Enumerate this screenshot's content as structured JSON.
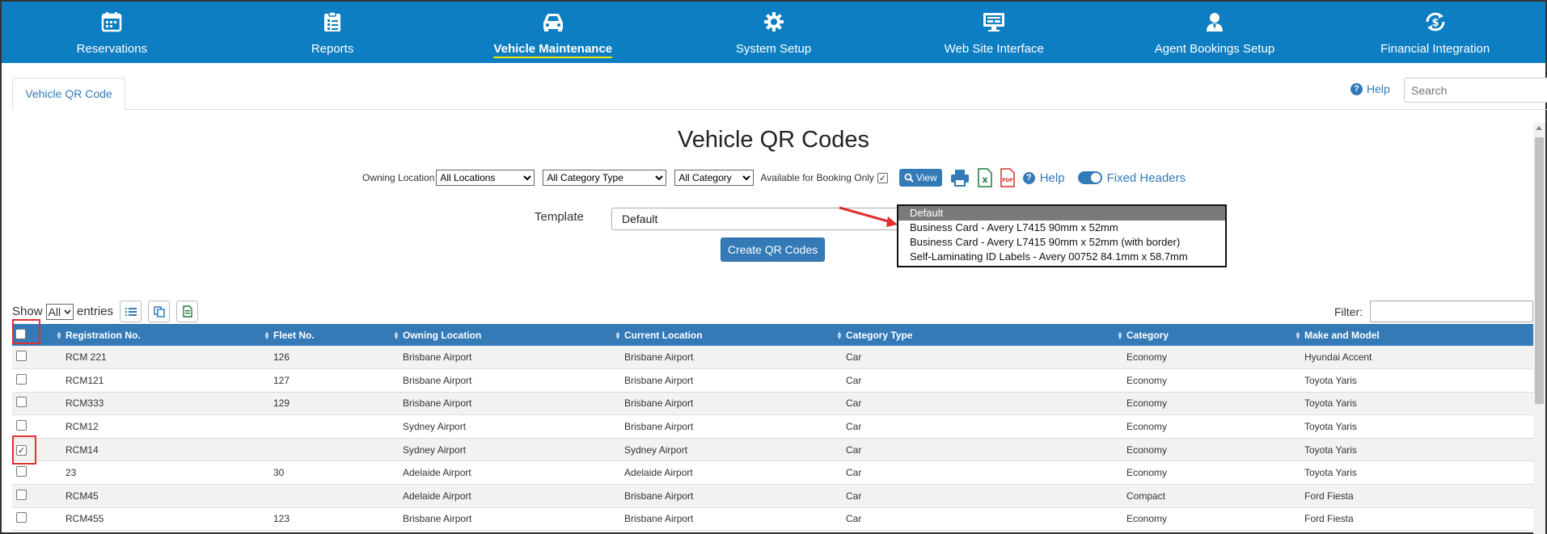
{
  "nav": {
    "items": [
      {
        "label": "Reservations",
        "icon": "calendar-icon"
      },
      {
        "label": "Reports",
        "icon": "clipboard-icon"
      },
      {
        "label": "Vehicle Maintenance",
        "icon": "car-icon"
      },
      {
        "label": "System Setup",
        "icon": "gear-icon"
      },
      {
        "label": "Web Site Interface",
        "icon": "monitor-icon"
      },
      {
        "label": "Agent Bookings Setup",
        "icon": "agent-icon"
      },
      {
        "label": "Financial Integration",
        "icon": "refresh-dollar-icon"
      }
    ],
    "active_index": 2,
    "bg_color": "#0d7ec2",
    "active_underline_color": "#f7e600"
  },
  "tab": {
    "label": "Vehicle QR Code"
  },
  "top_help": {
    "label": "Help"
  },
  "search": {
    "placeholder": "Search"
  },
  "title": "Vehicle QR Codes",
  "filters": {
    "owning_location_label": "Owning Location",
    "owning_location_value": "All Locations",
    "category_type_value": "All Category Type",
    "category_value": "All Category",
    "available_label": "Available for Booking Only",
    "available_checked": true,
    "view_label": "View",
    "help_label": "Help",
    "fixed_headers_label": "Fixed Headers",
    "fixed_headers_on": true
  },
  "template": {
    "label": "Template",
    "value": "Default",
    "options": [
      "Default",
      "Business Card - Avery L7415 90mm x 52mm",
      "Business Card - Avery L7415 90mm x 52mm (with border)",
      "Self-Laminating ID Labels - Avery 00752 84.1mm x 58.7mm"
    ],
    "selected_option": "Default"
  },
  "create_button": "Create QR Codes",
  "table_controls": {
    "show_label": "Show",
    "entries_value": "All",
    "entries_label": "entries",
    "filter_label": "Filter:"
  },
  "table": {
    "columns": [
      "Registration No.",
      "Fleet No.",
      "Owning Location",
      "Current Location",
      "Category Type",
      "Category",
      "Make and Model"
    ],
    "rows": [
      {
        "checked": false,
        "cells": [
          "RCM 221",
          "126",
          "Brisbane Airport",
          "Brisbane Airport",
          "Car",
          "Economy",
          "Hyundai Accent"
        ]
      },
      {
        "checked": false,
        "cells": [
          "RCM121",
          "127",
          "Brisbane Airport",
          "Brisbane Airport",
          "Car",
          "Economy",
          "Toyota Yaris"
        ]
      },
      {
        "checked": false,
        "cells": [
          "RCM333",
          "129",
          "Brisbane Airport",
          "Brisbane Airport",
          "Car",
          "Economy",
          "Toyota Yaris"
        ]
      },
      {
        "checked": false,
        "cells": [
          "RCM12",
          "",
          "Sydney Airport",
          "Brisbane Airport",
          "Car",
          "Economy",
          "Toyota Yaris"
        ]
      },
      {
        "checked": true,
        "cells": [
          "RCM14",
          "",
          "Sydney Airport",
          "Sydney Airport",
          "Car",
          "Economy",
          "Toyota Yaris"
        ]
      },
      {
        "checked": false,
        "cells": [
          "23",
          "30",
          "Adelaide Airport",
          "Adelaide Airport",
          "Car",
          "Economy",
          "Toyota Yaris"
        ]
      },
      {
        "checked": false,
        "cells": [
          "RCM45",
          "",
          "Adelaide Airport",
          "Brisbane Airport",
          "Car",
          "Compact",
          "Ford Fiesta"
        ]
      },
      {
        "checked": false,
        "cells": [
          "RCM455",
          "123",
          "Brisbane Airport",
          "Brisbane Airport",
          "Car",
          "Economy",
          "Ford Fiesta"
        ]
      }
    ],
    "header_color": "#337ab7"
  },
  "annotation_color": "#e03030"
}
